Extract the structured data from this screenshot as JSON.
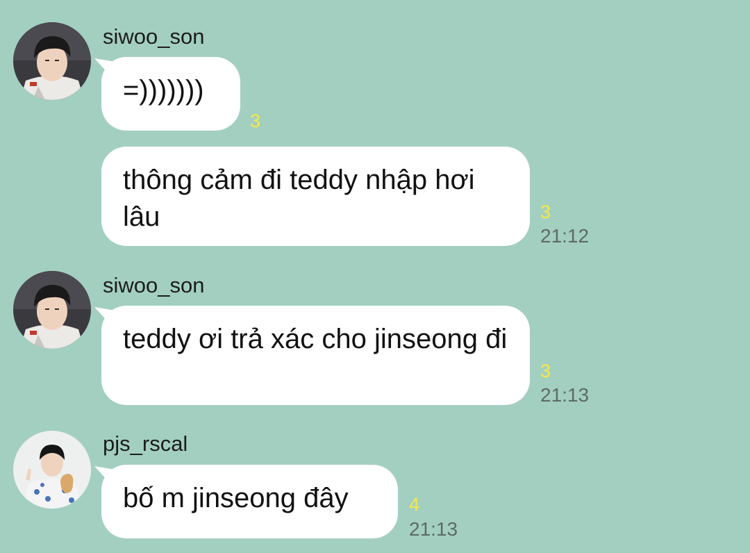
{
  "colors": {
    "background": "#a3cfc1",
    "bubble": "#ffffff",
    "unread": "#f5e84a",
    "time": "#5d6a66"
  },
  "messages": [
    {
      "sender": "siwoo_son",
      "text": "=)))))))",
      "unread": "3",
      "time": ""
    },
    {
      "sender": "",
      "text": "thông cảm đi teddy nhập hơi lâu",
      "unread": "3",
      "time": "21:12"
    },
    {
      "sender": "siwoo_son",
      "text": "teddy ơi trả xác cho jinseong đi",
      "unread": "3",
      "time": "21:13"
    },
    {
      "sender": "pjs_rscal",
      "text": "bố m jinseong đây",
      "unread": "4",
      "time": "21:13"
    }
  ]
}
